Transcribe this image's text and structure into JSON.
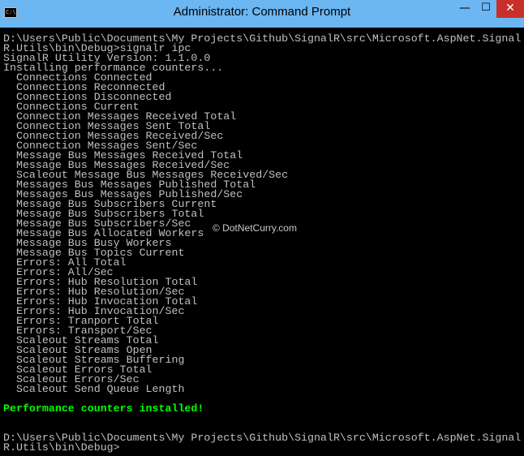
{
  "window": {
    "title": "Administrator: Command Prompt",
    "icon_label": "C:\\.",
    "controls": {
      "minimize": "—",
      "maximize": "☐",
      "close": "✕"
    }
  },
  "console": {
    "lines": [
      {
        "text": "D:\\Users\\Public\\Documents\\My Projects\\Github\\SignalR\\src\\Microsoft.AspNet.Signal",
        "kind": "normal"
      },
      {
        "text": "R.Utils\\bin\\Debug>signalr ipc",
        "kind": "normal"
      },
      {
        "text": "SignalR Utility Version: 1.1.0.0",
        "kind": "normal"
      },
      {
        "text": "Installing performance counters...",
        "kind": "normal"
      },
      {
        "text": "  Connections Connected",
        "kind": "normal"
      },
      {
        "text": "  Connections Reconnected",
        "kind": "normal"
      },
      {
        "text": "  Connections Disconnected",
        "kind": "normal"
      },
      {
        "text": "  Connections Current",
        "kind": "normal"
      },
      {
        "text": "  Connection Messages Received Total",
        "kind": "normal"
      },
      {
        "text": "  Connection Messages Sent Total",
        "kind": "normal"
      },
      {
        "text": "  Connection Messages Received/Sec",
        "kind": "normal"
      },
      {
        "text": "  Connection Messages Sent/Sec",
        "kind": "normal"
      },
      {
        "text": "  Message Bus Messages Received Total",
        "kind": "normal"
      },
      {
        "text": "  Message Bus Messages Received/Sec",
        "kind": "normal"
      },
      {
        "text": "  Scaleout Message Bus Messages Received/Sec",
        "kind": "normal"
      },
      {
        "text": "  Messages Bus Messages Published Total",
        "kind": "normal"
      },
      {
        "text": "  Messages Bus Messages Published/Sec",
        "kind": "normal"
      },
      {
        "text": "  Message Bus Subscribers Current",
        "kind": "normal"
      },
      {
        "text": "  Message Bus Subscribers Total",
        "kind": "normal"
      },
      {
        "text": "  Message Bus Subscribers/Sec",
        "kind": "normal"
      },
      {
        "text": "  Message Bus Allocated Workers",
        "kind": "normal"
      },
      {
        "text": "  Message Bus Busy Workers",
        "kind": "normal"
      },
      {
        "text": "  Message Bus Topics Current",
        "kind": "normal"
      },
      {
        "text": "  Errors: All Total",
        "kind": "normal"
      },
      {
        "text": "  Errors: All/Sec",
        "kind": "normal"
      },
      {
        "text": "  Errors: Hub Resolution Total",
        "kind": "normal"
      },
      {
        "text": "  Errors: Hub Resolution/Sec",
        "kind": "normal"
      },
      {
        "text": "  Errors: Hub Invocation Total",
        "kind": "normal"
      },
      {
        "text": "  Errors: Hub Invocation/Sec",
        "kind": "normal"
      },
      {
        "text": "  Errors: Tranport Total",
        "kind": "normal"
      },
      {
        "text": "  Errors: Transport/Sec",
        "kind": "normal"
      },
      {
        "text": "  Scaleout Streams Total",
        "kind": "normal"
      },
      {
        "text": "  Scaleout Streams Open",
        "kind": "normal"
      },
      {
        "text": "  Scaleout Streams Buffering",
        "kind": "normal"
      },
      {
        "text": "  Scaleout Errors Total",
        "kind": "normal"
      },
      {
        "text": "  Scaleout Errors/Sec",
        "kind": "normal"
      },
      {
        "text": "  Scaleout Send Queue Length",
        "kind": "normal"
      },
      {
        "text": "",
        "kind": "normal"
      },
      {
        "text": "Performance counters installed!",
        "kind": "success"
      },
      {
        "text": "",
        "kind": "normal"
      },
      {
        "text": "",
        "kind": "normal"
      },
      {
        "text": "D:\\Users\\Public\\Documents\\My Projects\\Github\\SignalR\\src\\Microsoft.AspNet.Signal",
        "kind": "normal"
      },
      {
        "text": "R.Utils\\bin\\Debug>",
        "kind": "normal"
      }
    ],
    "watermark": "© DotNetCurry.com"
  }
}
